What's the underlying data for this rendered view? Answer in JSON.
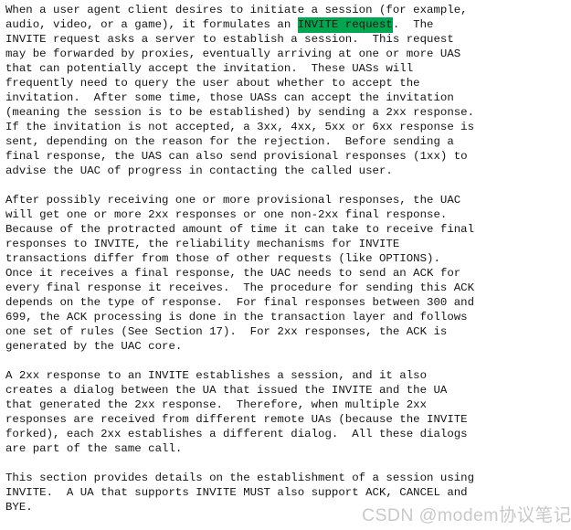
{
  "document": {
    "type": "rfc-text-excerpt",
    "text_color": "#141414",
    "background_color": "#ffffff",
    "highlight_color": "#00a650",
    "paragraphs": [
      {
        "id": "p1",
        "before_highlight": "When a user agent client desires to initiate a session (for example,\naudio, video, or a game), it formulates an ",
        "highlight": "INVITE request",
        "after_highlight": ".  The\nINVITE request asks a server to establish a session.  This request\nmay be forwarded by proxies, eventually arriving at one or more UAS\nthat can potentially accept the invitation.  These UASs will\nfrequently need to query the user about whether to accept the\ninvitation.  After some time, those UASs can accept the invitation\n(meaning the session is to be established) by sending a 2xx response.\nIf the invitation is not accepted, a 3xx, 4xx, 5xx or 6xx response is\nsent, depending on the reason for the rejection.  Before sending a\nfinal response, the UAS can also send provisional responses (1xx) to\nadvise the UAC of progress in contacting the called user."
      },
      {
        "id": "p2",
        "text": "After possibly receiving one or more provisional responses, the UAC\nwill get one or more 2xx responses or one non-2xx final response.\nBecause of the protracted amount of time it can take to receive final\nresponses to INVITE, the reliability mechanisms for INVITE\ntransactions differ from those of other requests (like OPTIONS).\nOnce it receives a final response, the UAC needs to send an ACK for\nevery final response it receives.  The procedure for sending this ACK\ndepends on the type of response.  For final responses between 300 and\n699, the ACK processing is done in the transaction layer and follows\none set of rules (See Section 17).  For 2xx responses, the ACK is\ngenerated by the UAC core."
      },
      {
        "id": "p3",
        "text": "A 2xx response to an INVITE establishes a session, and it also\ncreates a dialog between the UA that issued the INVITE and the UA\nthat generated the 2xx response.  Therefore, when multiple 2xx\nresponses are received from different remote UAs (because the INVITE\nforked), each 2xx establishes a different dialog.  All these dialogs\nare part of the same call."
      },
      {
        "id": "p4",
        "text": "This section provides details on the establishment of a session using\nINVITE.  A UA that supports INVITE MUST also support ACK, CANCEL and\nBYE."
      }
    ]
  },
  "watermark": {
    "text": "CSDN @modem协议笔记",
    "color": "#c9c9c9"
  }
}
